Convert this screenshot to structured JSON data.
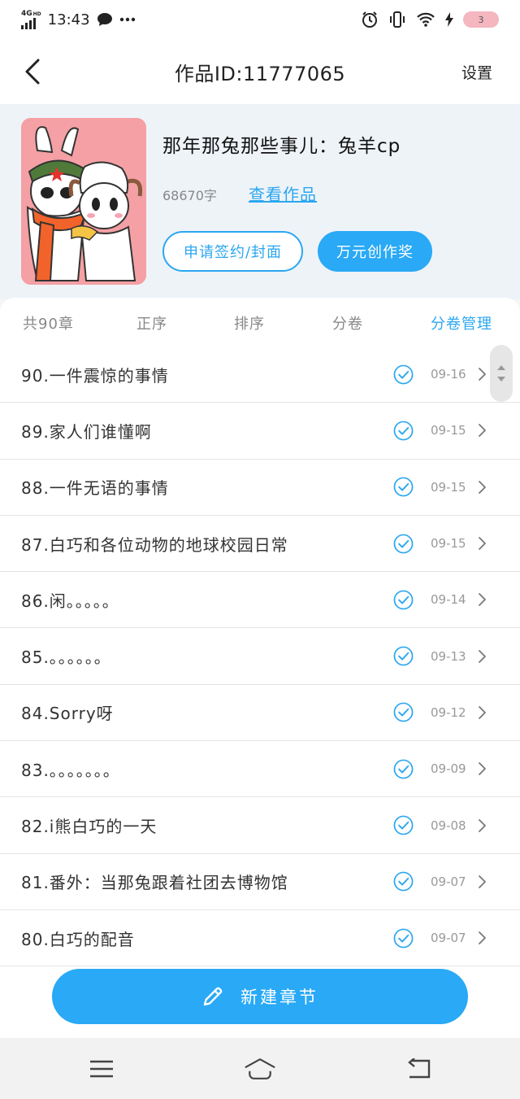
{
  "status_bar": {
    "network": "4G",
    "network_sub": "HD",
    "time": "13:43",
    "battery": "3"
  },
  "header": {
    "title": "作品ID:11777065",
    "settings_label": "设置"
  },
  "work": {
    "title": "那年那兔那些事儿：兔羊cp",
    "word_count": "68670字",
    "view_label": "查看作品",
    "sign_button": "申请签约/封面",
    "award_button": "万元创作奖"
  },
  "tabs": {
    "total": "共90章",
    "order": "正序",
    "sort": "排序",
    "volume": "分卷",
    "volume_manage": "分卷管理"
  },
  "chapters": [
    {
      "title": "90.一件震惊的事情",
      "date": "09-16"
    },
    {
      "title": "89.家人们谁懂啊",
      "date": "09-15"
    },
    {
      "title": "88.一件无语的事情",
      "date": "09-15"
    },
    {
      "title": "87.白巧和各位动物的地球校园日常",
      "date": "09-15"
    },
    {
      "title": "86.闲。。。。。",
      "date": "09-14"
    },
    {
      "title": "85.。。。。。。",
      "date": "09-13"
    },
    {
      "title": "84.Sorry呀",
      "date": "09-12"
    },
    {
      "title": "83.。。。。。。。",
      "date": "09-09"
    },
    {
      "title": "82.i熊白巧的一天",
      "date": "09-08"
    },
    {
      "title": "81.番外：当那兔跟着社团去博物馆",
      "date": "09-07"
    },
    {
      "title": "80.白巧的配音",
      "date": "09-07"
    }
  ],
  "new_chapter_label": "新建章节",
  "colors": {
    "accent": "#29a9f6",
    "cover_bg": "#f4a0a4",
    "panel_bg": "#eef3f8"
  }
}
